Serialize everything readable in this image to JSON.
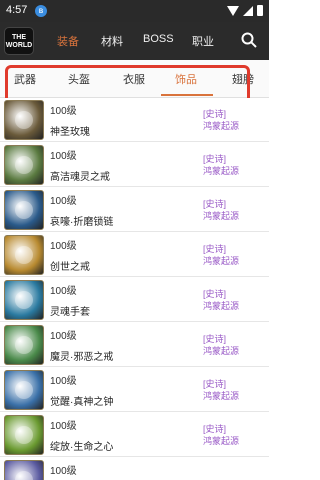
{
  "statusbar": {
    "time": "4:57",
    "badge": "ʙ"
  },
  "appbar": {
    "logo_line1": "THE",
    "logo_line2": "WORLD",
    "nav": [
      "装备",
      "材料",
      "BOSS",
      "职业"
    ],
    "active_nav": 0,
    "search_icon": "search-icon"
  },
  "tabs": [
    "武器",
    "头盔",
    "衣服",
    "饰品",
    "翅膀"
  ],
  "active_tab": 3,
  "colors": {
    "accent": "#d9733c",
    "highlight": "#e03a2c",
    "tag": "#9a5bc7",
    "bar": "#2b2b2b"
  },
  "items": [
    {
      "level": "100级",
      "name": "神圣玫瑰",
      "rarity": "[史诗]",
      "source": "鸿蒙起源",
      "thumb_color": "#6a5a3a"
    },
    {
      "level": "100级",
      "name": "高洁魂灵之戒",
      "rarity": "[史诗]",
      "source": "鸿蒙起源",
      "thumb_color": "#5a7a40"
    },
    {
      "level": "100级",
      "name": "哀嚎·折磨锁链",
      "rarity": "[史诗]",
      "source": "鸿蒙起源",
      "thumb_color": "#2a5a8a"
    },
    {
      "level": "100级",
      "name": "创世之戒",
      "rarity": "[史诗]",
      "source": "鸿蒙起源",
      "thumb_color": "#b88a30"
    },
    {
      "level": "100级",
      "name": "灵魂手套",
      "rarity": "[史诗]",
      "source": "鸿蒙起源",
      "thumb_color": "#2a7aa0"
    },
    {
      "level": "100级",
      "name": "魔灵·邪恶之戒",
      "rarity": "[史诗]",
      "source": "鸿蒙起源",
      "thumb_color": "#4a8a4a"
    },
    {
      "level": "100级",
      "name": "觉醒·真神之钟",
      "rarity": "[史诗]",
      "source": "鸿蒙起源",
      "thumb_color": "#3a70a8"
    },
    {
      "level": "100级",
      "name": "绽放·生命之心",
      "rarity": "[史诗]",
      "source": "鸿蒙起源",
      "thumb_color": "#6a9a30"
    },
    {
      "level": "100级",
      "name": "",
      "rarity": "",
      "source": "",
      "thumb_color": "#5a5aa0"
    }
  ]
}
